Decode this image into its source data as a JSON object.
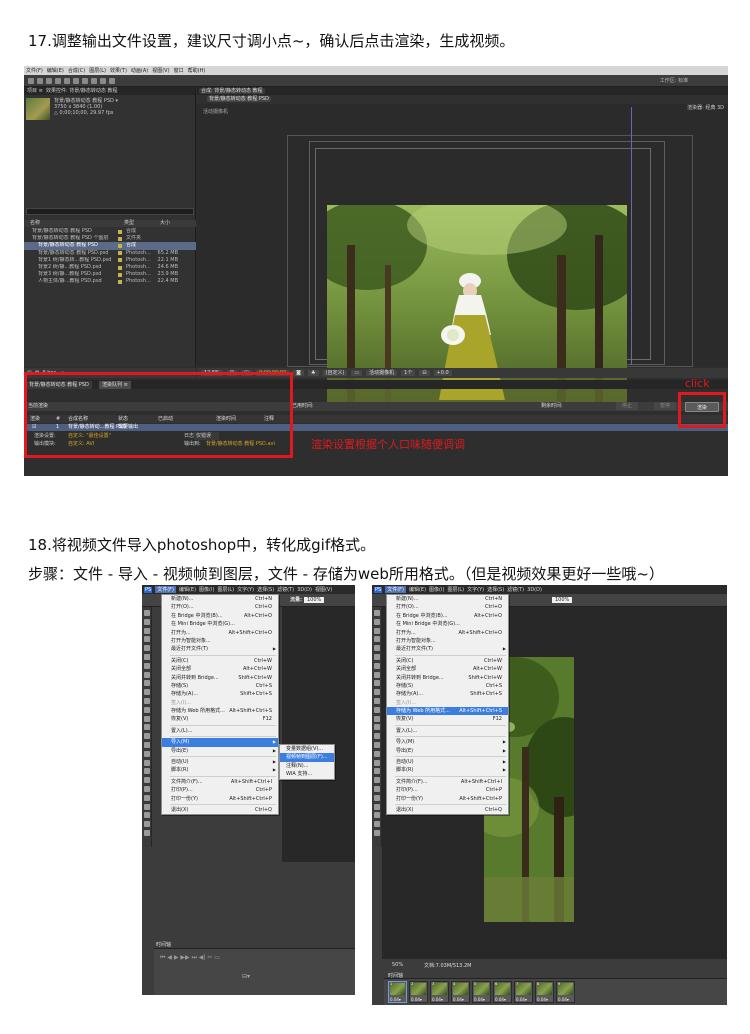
{
  "headings": {
    "step17": "17.调整输出文件设置，建议尺寸调小点~，确认后点击渲染，生成视频。",
    "step18": "18.将视频文件导入photoshop中，转化成gif格式。",
    "step18_detail": "步骤：文件 - 导入 - 视频帧到图层，文件 - 存储为web所用格式。（但是视频效果更好一些哦~）"
  },
  "annotations": {
    "click": "click",
    "render_note": "渲染设置根据个人口味随便调调"
  },
  "colors": {
    "annotation_red": "#e0191e",
    "menu_highlight": "#3b7ee0",
    "ae_link": "#d6a420"
  },
  "ae": {
    "menus": [
      "文件(F)",
      "编辑(E)",
      "合成(C)",
      "图层(L)",
      "效果(T)",
      "动画(A)",
      "视图(V)",
      "窗口",
      "帮助(H)"
    ],
    "workspace": "工作区: 标准",
    "project_tab": "项目 ≡",
    "effect_tab": "效果控件: 背景/静态转动态 教程",
    "comp_tab": "合成: 背景/静态转动态 教程",
    "comp_name": "背景/静态转动态 教程 PSD ▾",
    "comp_size": "3750 x 3840 (1.00)",
    "comp_duration": "△ 0;00;10;00, 29.97 fps",
    "columns": {
      "name": "名称",
      "type": "类型",
      "size": "大小"
    },
    "project_items": [
      {
        "name": "背景/静态转动态 教程 PSD",
        "type": "合成",
        "size": ""
      },
      {
        "name": "背景/静态转动态 教程 PSD 个图层",
        "type": "文件夹",
        "size": ""
      },
      {
        "name": "背景/静态转动态 教程 PSD",
        "type": "合成",
        "size": ""
      },
      {
        "name": "背景/静态转动态 教程 PSD.psd",
        "type": "Photosh...",
        "size": "65.2 MB"
      },
      {
        "name": "背景1 树/静态转...教程 PSD.psd",
        "type": "Photosh...",
        "size": "22.1 MB"
      },
      {
        "name": "背景2 树/静...教程 PSD.psd",
        "type": "Photosh...",
        "size": "24.6 MB"
      },
      {
        "name": "背景3 树/静...教程 PSD.psd",
        "type": "Photosh...",
        "size": "23.9 MB"
      },
      {
        "name": "人物主体/静...教程 PSD.psd",
        "type": "Photosh...",
        "size": "22.4 MB"
      }
    ],
    "comp_subtab": "背景/静态转动态 教程 PSD",
    "camera_label": "活动摄像机",
    "renderer": "渲染器: 经典 3D",
    "viewer_bar": [
      "12.5%",
      "⊞",
      "◫",
      "0;00;00;00",
      "◙",
      "♣",
      "(自定义)",
      "▭",
      "活动摄像机",
      "1个",
      "⊟",
      "+0.0"
    ],
    "left_bar": "8 bpc",
    "timeline_tabs": [
      "背景/静态转动态 教程 PSD",
      "渲染队列 ≡"
    ],
    "render_header": "当前渲染",
    "elapsed_label": "已用时间:",
    "remain_label": "剩余时间:",
    "stop": "停止",
    "pause": "暂停",
    "render_button": "渲染",
    "queue_columns": {
      "render": "渲染",
      "num": "#",
      "comp_name": "合成名称",
      "status": "状态",
      "started": "已启动",
      "render_time": "渲染时间",
      "comment": "注释"
    },
    "queue_item": {
      "num": "1",
      "comp": "背景/静态转动...教程 PSD",
      "status": "需要输出"
    },
    "render_settings_label": "渲染设置:",
    "render_settings_value": "自定义: \"最佳设置\"",
    "output_module_label": "输出模块:",
    "output_module_value": "自定义: AVI",
    "log_label": "日志:",
    "log_value": "仅错误",
    "output_to_label": "输出到:",
    "output_to_value": "背景/静态转动态 教程 PSD.avi"
  },
  "ps_left": {
    "menus": [
      "PS",
      "文件(F)",
      "编辑(E)",
      "图像(I)",
      "图层(L)",
      "文字(Y)",
      "选择(S)",
      "滤镜(T)",
      "3D(D)",
      "视图(V)"
    ],
    "flow_label": "流量:",
    "flow_value": "100%",
    "file_menu": [
      {
        "label": "新建(N)...",
        "shortcut": "Ctrl+N"
      },
      {
        "label": "打开(O)...",
        "shortcut": "Ctrl+O"
      },
      {
        "label": "在 Bridge 中浏览(B)...",
        "shortcut": "Alt+Ctrl+O"
      },
      {
        "label": "在 Mini Bridge 中浏览(G)...",
        "shortcut": ""
      },
      {
        "label": "打开为...",
        "shortcut": "Alt+Shift+Ctrl+O"
      },
      {
        "label": "打开为智能对象...",
        "shortcut": ""
      },
      {
        "label": "最近打开文件(T)",
        "shortcut": ""
      },
      {
        "label": "关闭(C)",
        "shortcut": "Ctrl+W"
      },
      {
        "label": "关闭全部",
        "shortcut": "Alt+Ctrl+W"
      },
      {
        "label": "关闭并转到 Bridge...",
        "shortcut": "Shift+Ctrl+W"
      },
      {
        "label": "存储(S)",
        "shortcut": "Ctrl+S"
      },
      {
        "label": "存储为(A)...",
        "shortcut": "Shift+Ctrl+S"
      },
      {
        "label": "签入(I)...",
        "shortcut": ""
      },
      {
        "label": "存储为 Web 所用格式...",
        "shortcut": "Alt+Shift+Ctrl+S"
      },
      {
        "label": "恢复(V)",
        "shortcut": "F12"
      },
      {
        "label": "置入(L)...",
        "shortcut": ""
      },
      {
        "label": "导入(M)",
        "shortcut": ""
      },
      {
        "label": "导出(E)",
        "shortcut": ""
      },
      {
        "label": "自动(U)",
        "shortcut": ""
      },
      {
        "label": "脚本(R)",
        "shortcut": ""
      },
      {
        "label": "文件简介(F)...",
        "shortcut": "Alt+Shift+Ctrl+I"
      },
      {
        "label": "打印(P)...",
        "shortcut": "Ctrl+P"
      },
      {
        "label": "打印一份(Y)",
        "shortcut": "Alt+Shift+Ctrl+P"
      },
      {
        "label": "退出(X)",
        "shortcut": "Ctrl+Q"
      }
    ],
    "import_submenu": [
      "变量数据组(V)...",
      "视频帧到图层(F)...",
      "注释(N)...",
      "WIA 支持..."
    ],
    "timeline_title": "时间轴"
  },
  "ps_right": {
    "menus": [
      "PS",
      "文件(F)",
      "编辑(E)",
      "图像(I)",
      "图层(L)",
      "文字(Y)",
      "选择(S)",
      "滤镜(T)",
      "3D(D)"
    ],
    "flow_value": "100%",
    "file_menu": [
      {
        "label": "新建(N)...",
        "shortcut": "Ctrl+N"
      },
      {
        "label": "打开(O)...",
        "shortcut": "Ctrl+O"
      },
      {
        "label": "在 Bridge 中浏览(B)...",
        "shortcut": "Alt+Ctrl+O"
      },
      {
        "label": "在 Mini Bridge 中浏览(G)...",
        "shortcut": ""
      },
      {
        "label": "打开为...",
        "shortcut": "Alt+Shift+Ctrl+O"
      },
      {
        "label": "打开为智能对象...",
        "shortcut": ""
      },
      {
        "label": "最近打开文件(T)",
        "shortcut": ""
      },
      {
        "label": "关闭(C)",
        "shortcut": "Ctrl+W"
      },
      {
        "label": "关闭全部",
        "shortcut": "Alt+Ctrl+W"
      },
      {
        "label": "关闭并转到 Bridge...",
        "shortcut": "Shift+Ctrl+W"
      },
      {
        "label": "存储(S)",
        "shortcut": "Ctrl+S"
      },
      {
        "label": "存储为(A)...",
        "shortcut": "Shift+Ctrl+S"
      },
      {
        "label": "签入(I)...",
        "shortcut": ""
      },
      {
        "label": "存储为 Web 所用格式...",
        "shortcut": "Alt+Shift+Ctrl+S"
      },
      {
        "label": "恢复(V)",
        "shortcut": "F12"
      },
      {
        "label": "置入(L)...",
        "shortcut": ""
      },
      {
        "label": "导入(M)",
        "shortcut": ""
      },
      {
        "label": "导出(E)",
        "shortcut": ""
      },
      {
        "label": "自动(U)",
        "shortcut": ""
      },
      {
        "label": "脚本(R)",
        "shortcut": ""
      },
      {
        "label": "文件简介(F)...",
        "shortcut": "Alt+Shift+Ctrl+I"
      },
      {
        "label": "打印(P)...",
        "shortcut": "Ctrl+P"
      },
      {
        "label": "打印一份(Y)",
        "shortcut": "Alt+Shift+Ctrl+P"
      },
      {
        "label": "退出(X)",
        "shortcut": "Ctrl+Q"
      }
    ],
    "zoom": "50%",
    "doc_info": "文档:7.03M/513.2M",
    "timeline_title": "时间轴",
    "frames": [
      {
        "n": "1",
        "delay": "0.04▾"
      },
      {
        "n": "2",
        "delay": "0.04▾"
      },
      {
        "n": "3",
        "delay": "0.04▾"
      },
      {
        "n": "4",
        "delay": "0.04▾"
      },
      {
        "n": "5",
        "delay": "0.04▾"
      },
      {
        "n": "6",
        "delay": "0.04▾"
      },
      {
        "n": "7",
        "delay": "0.04▾"
      },
      {
        "n": "8",
        "delay": "0.04▾"
      },
      {
        "n": "9",
        "delay": "0.04▾"
      }
    ]
  }
}
